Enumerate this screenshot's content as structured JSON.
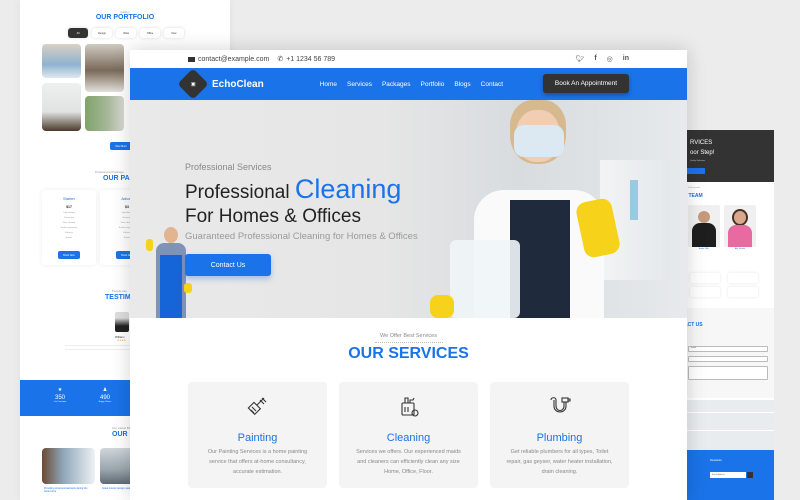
{
  "left_page": {
    "portfolio_small": "Gallery",
    "portfolio_title": "OUR PORTFOLIO",
    "filters": [
      "All",
      "Design",
      "Villas",
      "Office",
      "New"
    ],
    "view_more": "View More",
    "packages_small": "Professional Package",
    "packages_title": "OUR PAC",
    "packages": [
      {
        "name": "Starter",
        "price": "$17",
        "features": [
          "Light dusting",
          "Vacuuming",
          "Floor cleaning",
          "Surface inspection",
          "Kitchens",
          "Rooms"
        ],
        "button": "Book Now"
      },
      {
        "name": "Advan",
        "price": "$3",
        "features": [
          "Light dusting",
          "Vacuuming",
          "Floor cleaning",
          "Surface inspection",
          "Kitchens",
          "Rooms"
        ],
        "button": "Book Now"
      }
    ],
    "testimonials_small": "People say",
    "testimonials_title": "TESTIMO",
    "testimonial_name": "William",
    "stats": [
      {
        "value": "350",
        "label": "Our Customer"
      },
      {
        "value": "490",
        "label": "Happy Clients"
      }
    ],
    "blog_small": "Our Latest Blog",
    "blog_title": "OUR B",
    "blog_captions": [
      "Providing structural warrants during the winter time",
      "Great interior design quality of life"
    ]
  },
  "right_page": {
    "hero_line1": "RVICES",
    "hero_line2": "oor Step!",
    "hero_line3": "Quality Solutions",
    "team_small": "Professionals",
    "team_title": "T TEAM",
    "members": [
      {
        "name": "Andre Wills",
        "role": "Cleaner Boss"
      },
      {
        "name": "Ally Jonson",
        "role": "Account Manager"
      }
    ],
    "contact_title": "ACT US",
    "email_placeholder": "Email",
    "newsletter_title": "Newsletter",
    "newsletter_placeholder": "Email Address"
  },
  "main": {
    "topbar": {
      "email": "contact@example.com",
      "phone": "+1 1234 56 789",
      "social": [
        "twitter-icon",
        "facebook-icon",
        "instagram-icon",
        "linkedin-icon"
      ]
    },
    "nav": {
      "logo_text": "EchoClean",
      "links": [
        "Home",
        "Services",
        "Packages",
        "Portfolio",
        "Blogs",
        "Contact"
      ],
      "cta": "Book An Appointment"
    },
    "hero": {
      "subtitle": "Professional Services",
      "title_part1": "Professional",
      "title_accent": "Cleaning",
      "title_line2": "For Homes & Offices",
      "tagline": "Guaranteed Professional Cleaning for Homes & Offices",
      "button": "Contact Us"
    },
    "services": {
      "subtitle": "We Offer Best Services",
      "title": "OUR SERVICES",
      "items": [
        {
          "icon": "paint-brush-icon",
          "title": "Painting",
          "desc": "Our Painting Services is a home painting service that offers at-home consultancy, accurate estimation."
        },
        {
          "icon": "cleaning-supplies-icon",
          "title": "Cleaning",
          "desc": "Services we offers. Our experienced maids and cleaners can efficiently clean any size Home, Office, Floor."
        },
        {
          "icon": "pipe-icon",
          "title": "Plumbing",
          "desc": "Get reliable plumbers for all types, Toilet repair, gas geyser, water heater installation, drain cleaning."
        }
      ]
    }
  },
  "colors": {
    "accent": "#1a73e8",
    "dark": "#333333",
    "card_bg": "#f4f4f4"
  }
}
